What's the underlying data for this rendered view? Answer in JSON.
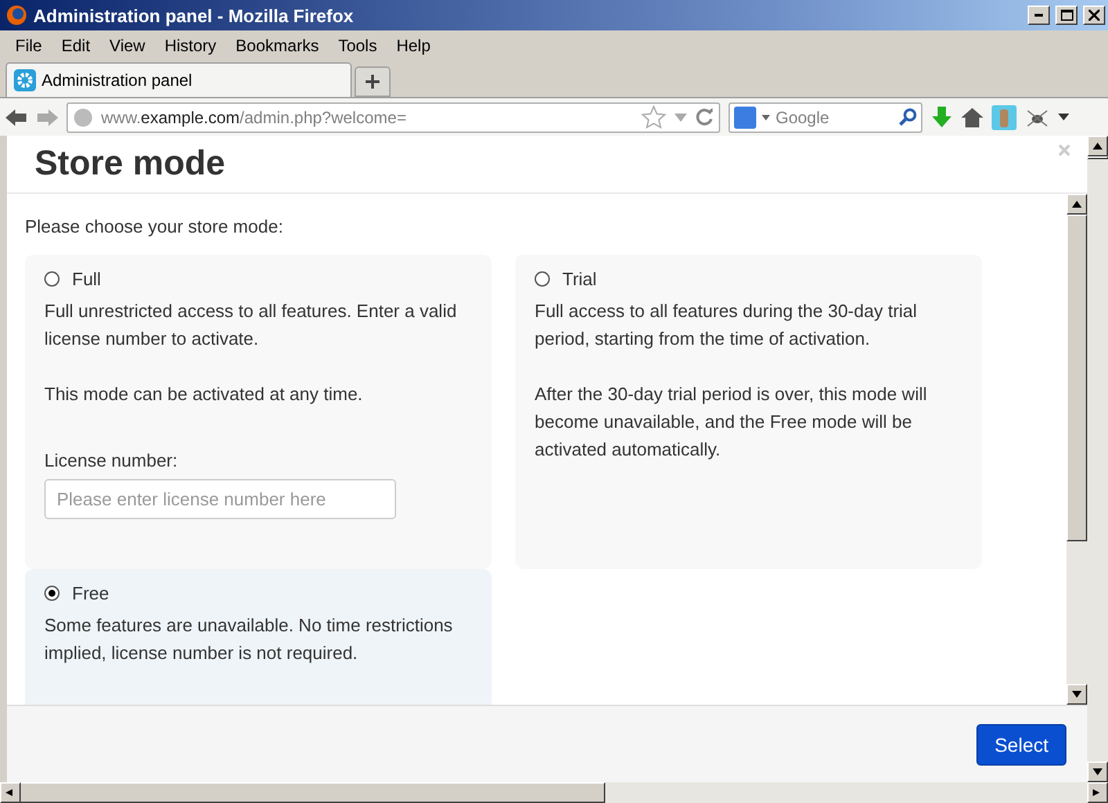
{
  "window": {
    "title": "Administration panel - Mozilla Firefox"
  },
  "menu": [
    "File",
    "Edit",
    "View",
    "History",
    "Bookmarks",
    "Tools",
    "Help"
  ],
  "tabs": [
    {
      "label": "Administration panel",
      "selected": true
    }
  ],
  "address": {
    "prefix": "www.",
    "domain": "example.com",
    "path": "/admin.php?welcome="
  },
  "search": {
    "placeholder": "Google"
  },
  "dialog": {
    "title": "Store mode",
    "prompt": "Please choose your store mode:",
    "modes": [
      {
        "label": "Full",
        "selected": false,
        "paragraphs": [
          "Full unrestricted access to all features. Enter a valid license number to activate.",
          "This mode can be activated at any time."
        ],
        "field": {
          "label": "License number:",
          "placeholder": "Please enter license number here"
        }
      },
      {
        "label": "Trial",
        "selected": false,
        "paragraphs": [
          "Full access to all features during the 30-day trial period, starting from the time of activation.",
          "After the 30-day trial period is over, this mode will become unavailable, and the Free mode will be activated automatically."
        ]
      },
      {
        "label": "Free",
        "selected": true,
        "paragraphs": [
          "Some features are unavailable. No time restrictions implied, license number is not required."
        ]
      }
    ],
    "button": "Select"
  }
}
